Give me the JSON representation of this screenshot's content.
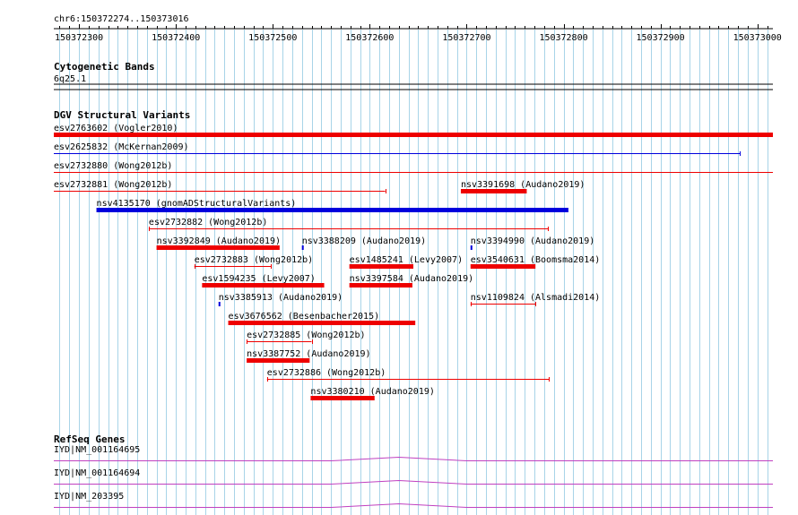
{
  "ruler": {
    "label": "chr6:150372274..150373016",
    "start": 150372274,
    "end": 150373016,
    "ticks": [
      "150372300",
      "150372400",
      "150372500",
      "150372600",
      "150372700",
      "150372800",
      "150372900",
      "150373000"
    ]
  },
  "cytogenetic": {
    "title": "Cytogenetic Bands",
    "band": "6q25.1"
  },
  "dgv": {
    "title": "DGV Structural Variants",
    "colors": {
      "red": "#ee0000",
      "blue": "#0000dd",
      "gain": "#0000ee",
      "loss": "#ee1111"
    },
    "variants": [
      {
        "label": "esv2763602 (Vogler2010)",
        "start": 150372274,
        "end": 150373016,
        "color": "red",
        "style": "bar"
      },
      {
        "label": "esv2625832 (McKernan2009)",
        "start": 150372274,
        "end": 150372982,
        "color": "blue",
        "style": "line"
      },
      {
        "label": "esv2732880 (Wong2012b)",
        "start": 150372274,
        "end": 150373016,
        "color": "red",
        "style": "line"
      },
      {
        "label": "esv2732881 (Wong2012b)",
        "start": 150372274,
        "end": 150372616,
        "color": "red",
        "style": "line"
      },
      {
        "label": "nsv3391698 (Audano2019)",
        "start": 150372694,
        "end": 150372762,
        "color": "red",
        "style": "bar"
      },
      {
        "label": "nsv4135170 (gnomADStructuralVariants)",
        "start": 150372318,
        "end": 150372805,
        "color": "blue",
        "style": "bar"
      },
      {
        "label": "esv2732882 (Wong2012b)",
        "start": 150372372,
        "end": 150372784,
        "color": "red",
        "style": "line"
      },
      {
        "label": "nsv3392849 (Audano2019)",
        "start": 150372380,
        "end": 150372507,
        "color": "red",
        "style": "bar"
      },
      {
        "label": "nsv3388209 (Audano2019)",
        "start": 150372530,
        "end": 150372531,
        "color": "blue",
        "style": "bar"
      },
      {
        "label": "nsv3394990 (Audano2019)",
        "start": 150372704,
        "end": 150372705,
        "color": "blue",
        "style": "bar"
      },
      {
        "label": "esv2732883 (Wong2012b)",
        "start": 150372419,
        "end": 150372498,
        "color": "red",
        "style": "line"
      },
      {
        "label": "esv1485241 (Levy2007)",
        "start": 150372579,
        "end": 150372645,
        "color": "red",
        "style": "bar"
      },
      {
        "label": "esv3540631 (Boomsma2014)",
        "start": 150372704,
        "end": 150372771,
        "color": "red",
        "style": "bar"
      },
      {
        "label": "esv1594235 (Levy2007)",
        "start": 150372427,
        "end": 150372553,
        "color": "red",
        "style": "bar"
      },
      {
        "label": "nsv3397584 (Audano2019)",
        "start": 150372579,
        "end": 150372644,
        "color": "red",
        "style": "bar"
      },
      {
        "label": "nsv3385913 (Audano2019)",
        "start": 150372444,
        "end": 150372445,
        "color": "blue",
        "style": "bar"
      },
      {
        "label": "nsv1109824 (Alsmadi2014)",
        "start": 150372704,
        "end": 150372771,
        "color": "red",
        "style": "line"
      },
      {
        "label": "esv3676562 (Besenbacher2015)",
        "start": 150372454,
        "end": 150372647,
        "color": "red",
        "style": "bar"
      },
      {
        "label": "esv2732885 (Wong2012b)",
        "start": 150372473,
        "end": 150372540,
        "color": "red",
        "style": "line"
      },
      {
        "label": "nsv3387752 (Audano2019)",
        "start": 150372473,
        "end": 150372538,
        "color": "red",
        "style": "bar"
      },
      {
        "label": "esv2732886 (Wong2012b)",
        "start": 150372494,
        "end": 150372785,
        "color": "red",
        "style": "line"
      },
      {
        "label": "nsv3380210 (Audano2019)",
        "start": 150372539,
        "end": 150372605,
        "color": "red",
        "style": "bar"
      }
    ]
  },
  "refseq": {
    "title": "RefSeq Genes",
    "color": "#c040c0",
    "transcripts": [
      "IYD|NM_001164695",
      "IYD|NM_001164694",
      "IYD|NM_203395"
    ]
  }
}
